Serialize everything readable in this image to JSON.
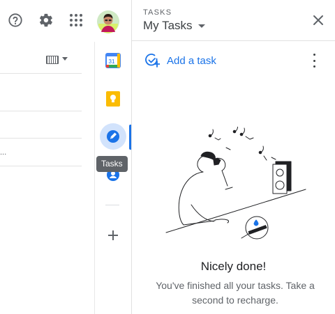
{
  "header": {
    "help_icon": "help-circle-icon",
    "settings_icon": "gear-icon",
    "apps_icon": "apps-grid-icon",
    "avatar_icon": "user-avatar"
  },
  "side_panel": {
    "items": [
      {
        "name": "calendar",
        "icon": "calendar-icon",
        "label": "31"
      },
      {
        "name": "keep",
        "icon": "keep-bulb-icon"
      },
      {
        "name": "tasks",
        "icon": "tasks-icon",
        "active": true
      },
      {
        "name": "contacts",
        "icon": "contacts-icon"
      }
    ],
    "tooltip": "Tasks",
    "add_icon": "plus-icon",
    "accent": "#1a73e8"
  },
  "left_pane": {
    "truncated_text": "..."
  },
  "tasks": {
    "header_label": "TASKS",
    "list_title": "My Tasks",
    "add_task_label": "Add a task",
    "empty_title": "Nicely done!",
    "empty_desc": "You've finished all your tasks. Take a second to recharge."
  }
}
